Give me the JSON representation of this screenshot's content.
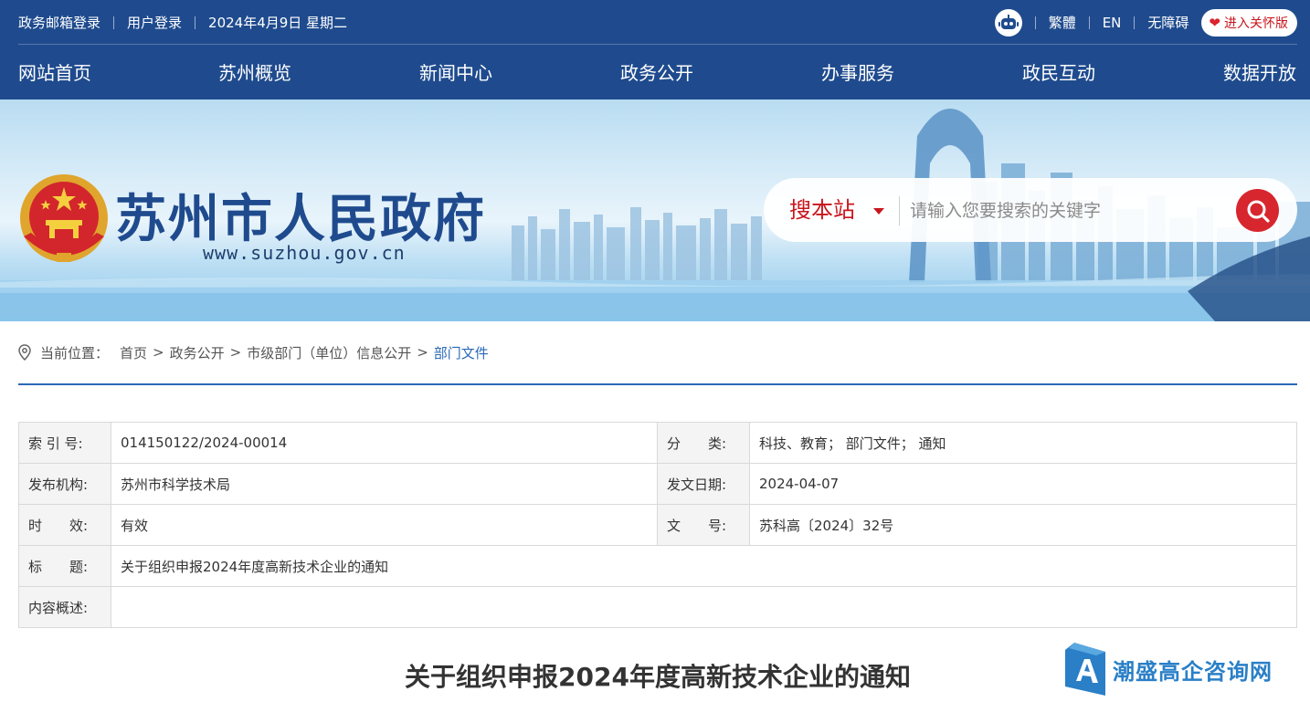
{
  "topbar": {
    "mail_login": "政务邮箱登录",
    "user_login": "用户登录",
    "date": "2024年4月9日 星期二",
    "traditional": "繁體",
    "english": "EN",
    "accessibility": "无障碍",
    "care_mode": "进入关怀版"
  },
  "nav": {
    "items": [
      "网站首页",
      "苏州概览",
      "新闻中心",
      "政务公开",
      "办事服务",
      "政民互动",
      "数据开放"
    ]
  },
  "banner": {
    "site_title": "苏州市人民政府",
    "site_url": "www.suzhou.gov.cn"
  },
  "search": {
    "scope": "搜本站",
    "placeholder": "请输入您要搜索的关键字"
  },
  "breadcrumb": {
    "label": "当前位置：",
    "items": [
      "首页",
      "政务公开",
      "市级部门（单位）信息公开",
      "部门文件"
    ]
  },
  "info_table": {
    "index_label": "索 引 号:",
    "index_value": "014150122/2024-00014",
    "category_label": "分　　类:",
    "category_value": "科技、教育；  部门文件；  通知",
    "publisher_label": "发布机构:",
    "publisher_value": "苏州市科学技术局",
    "date_label": "发文日期:",
    "date_value": "2024-04-07",
    "validity_label": "时　　效:",
    "validity_value": "有效",
    "docno_label": "文　　号:",
    "docno_value": "苏科高〔2024〕32号",
    "title_label": "标　　题:",
    "title_value": "关于组织申报2024年度高新技术企业的通知",
    "summary_label": "内容概述:",
    "summary_value": ""
  },
  "article": {
    "title": "关于组织申报2024年度高新技术企业的通知"
  },
  "watermark": {
    "text": "潮盛高企咨询网"
  },
  "colors": {
    "brand_blue": "#1f4b8e",
    "link_blue": "#2a68b6",
    "accent_red": "#c8161d"
  }
}
